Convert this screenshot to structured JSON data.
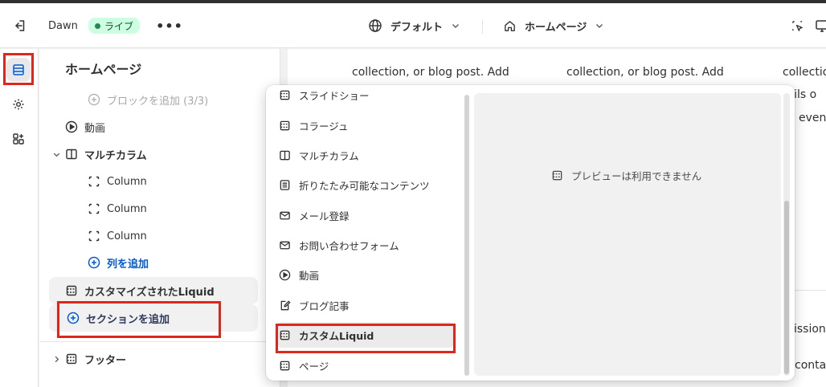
{
  "topbar": {
    "store_name": "Dawn",
    "status_badge": "ライブ",
    "more": "•••",
    "theme_select": "デフォルト",
    "page_select": "ホームページ"
  },
  "sidebar": {
    "title": "ホームページ",
    "items": [
      {
        "label": "ブロックを追加 (3/3)"
      },
      {
        "label": "動画"
      },
      {
        "label": "マルチカラム"
      },
      {
        "label": "Column"
      },
      {
        "label": "Column"
      },
      {
        "label": "Column"
      },
      {
        "label": "列を追加"
      },
      {
        "label": "カスタマイズされたLiquid"
      },
      {
        "label": "セクションを追加"
      },
      {
        "label": "フッター"
      }
    ]
  },
  "preview": {
    "col1_line": "collection, or blog post. Add",
    "col2_line": "collection, or blog post. Add",
    "col3_line1": "collectio",
    "col3_line2": "tails o",
    "col3_line3": "even",
    "right_text1": "ission",
    "right_text2": "conta"
  },
  "popover": {
    "items": [
      {
        "label": "スライドショー"
      },
      {
        "label": "コラージュ"
      },
      {
        "label": "マルチカラム"
      },
      {
        "label": "折りたたみ可能なコンテンツ"
      },
      {
        "label": "メール登録"
      },
      {
        "label": "お問い合わせフォーム"
      },
      {
        "label": "動画"
      },
      {
        "label": "ブログ記事"
      },
      {
        "label": "カスタムLiquid"
      },
      {
        "label": "ページ"
      }
    ],
    "preview_message": "プレビューは利用できません"
  },
  "colors": {
    "accent_blue": "#005bd3",
    "highlight_red": "#e0261b",
    "live_green": "#29845a"
  }
}
